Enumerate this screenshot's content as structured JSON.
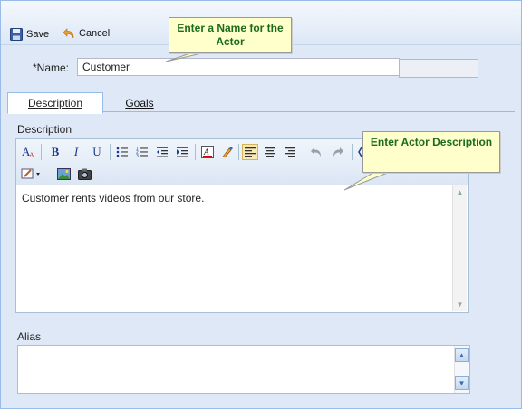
{
  "toolbar": {
    "save_label": "Save",
    "cancel_label": "Cancel"
  },
  "callouts": {
    "name_hint": "Enter a Name for the Actor",
    "desc_hint": "Enter Actor Description"
  },
  "form": {
    "name_label": "*Name:",
    "name_value": "Customer"
  },
  "tabs": [
    {
      "label": "Description",
      "active": true
    },
    {
      "label": "Goals",
      "active": false
    }
  ],
  "description": {
    "label": "Description",
    "text": "Customer rents videos from our store."
  },
  "alias": {
    "label": "Alias",
    "value": ""
  },
  "colors": {
    "accent": "#99bbe8",
    "callout_bg": "#ffffcc",
    "callout_text": "#1a6b1a",
    "active_tool": "#f7e9b5"
  },
  "editor_icons": [
    "font-size-icon",
    "bold-icon",
    "italic-icon",
    "underline-icon",
    "bullet-list-icon",
    "numbered-list-icon",
    "outdent-icon",
    "indent-icon",
    "text-color-icon",
    "highlight-icon",
    "align-left-icon",
    "align-center-icon",
    "align-right-icon",
    "undo-icon",
    "redo-icon",
    "source-edit-icon",
    "insert-image-icon",
    "insert-media-icon"
  ]
}
